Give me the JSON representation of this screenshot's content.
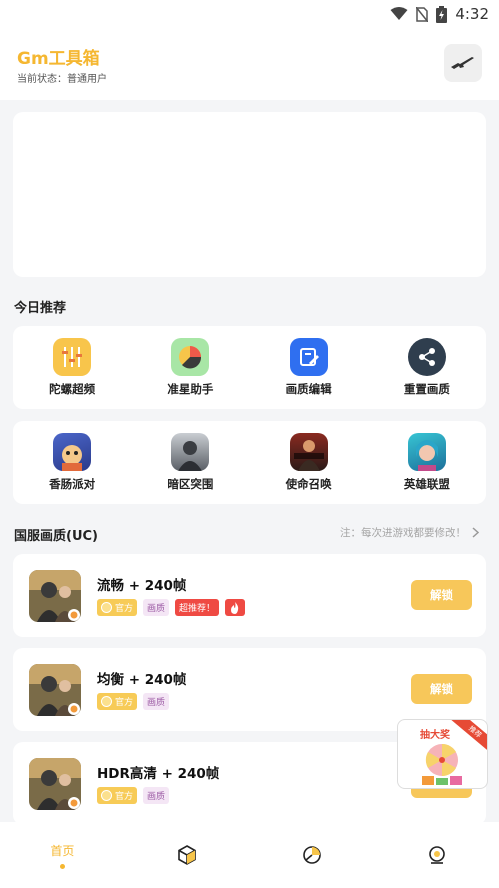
{
  "status": {
    "time": "4:32"
  },
  "header": {
    "title": "Gm工具箱",
    "state_label": "当前状态：普通用户"
  },
  "today": {
    "title": "今日推荐",
    "tools": [
      {
        "label": "陀螺超频",
        "icon": "gyro-icon"
      },
      {
        "label": "准星助手",
        "icon": "crosshair-icon"
      },
      {
        "label": "画质编辑",
        "icon": "edit-icon"
      },
      {
        "label": "重置画质",
        "icon": "share-icon"
      }
    ],
    "games": [
      {
        "label": "香肠派对",
        "icon": "sausage-party-icon"
      },
      {
        "label": "暗区突围",
        "icon": "arena-breakout-icon"
      },
      {
        "label": "使命召唤",
        "icon": "call-of-duty-icon"
      },
      {
        "label": "英雄联盟",
        "icon": "league-of-legends-icon"
      }
    ]
  },
  "graphics": {
    "title": "国服画质(UC)",
    "note": "注：每次进游戏都要修改！",
    "modes": [
      {
        "title": "流畅 + 240帧",
        "tag_official": "官方",
        "tag_quality": "画质",
        "tag_hot": "超推荐！",
        "button": "解锁"
      },
      {
        "title": "均衡 + 240帧",
        "tag_official": "官方",
        "tag_quality": "画质",
        "button": "解锁"
      },
      {
        "title": "HDR高清 + 240帧",
        "tag_official": "官方",
        "tag_quality": "画质",
        "button": "解锁"
      }
    ]
  },
  "lottery": {
    "title": "抽大奖",
    "ribbon": "推荐"
  },
  "tabbar": {
    "home_label": "首页"
  },
  "colors": {
    "accent": "#f5b731",
    "hot": "#ef4a43"
  }
}
